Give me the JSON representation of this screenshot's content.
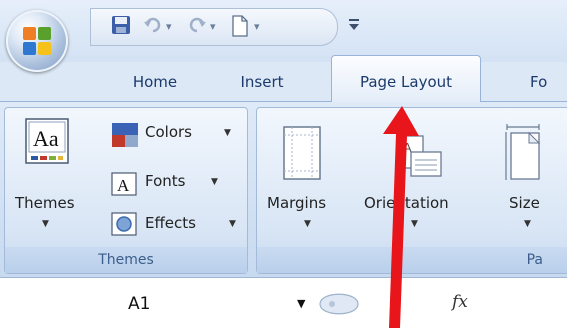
{
  "quick_access": {
    "icons": [
      "save-icon",
      "undo-icon",
      "redo-icon",
      "new-document-icon",
      "customize-dropdown-icon"
    ]
  },
  "tabs": [
    {
      "label": "Home",
      "active": false
    },
    {
      "label": "Insert",
      "active": false
    },
    {
      "label": "Page Layout",
      "active": true
    },
    {
      "label": "Fo",
      "active": false
    }
  ],
  "ribbon": {
    "themes_group": {
      "themes_label": "Themes",
      "colors_label": "Colors",
      "fonts_label": "Fonts",
      "effects_label": "Effects",
      "group_label": "Themes"
    },
    "page_setup_group": {
      "margins_label": "Margins",
      "orientation_label": "Orientation",
      "size_label": "Size",
      "group_label": "Pa"
    }
  },
  "formula_bar": {
    "name_box": "A1",
    "fx_label": "fx"
  },
  "colors": {
    "ribbon_bg": "#dce8f6",
    "tab_text": "#1b3a6b",
    "arrow": "#e8151b"
  }
}
